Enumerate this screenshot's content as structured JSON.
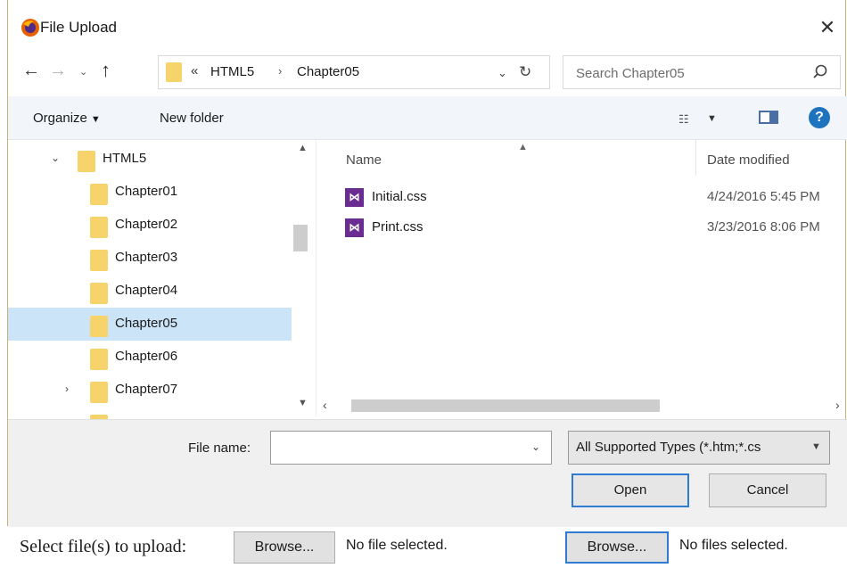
{
  "dialog": {
    "title": "File Upload",
    "close_symbol": "✕",
    "nav": {
      "back_symbol": "←",
      "forward_symbol": "→",
      "recent_symbol": "⌄",
      "up_symbol": "↑"
    },
    "address": {
      "overflow": "«",
      "segments": [
        "HTML5",
        "Chapter05"
      ],
      "separator": "›",
      "dropdown_symbol": "⌄",
      "refresh_symbol": "↻"
    },
    "search": {
      "placeholder": "Search Chapter05",
      "value": ""
    },
    "toolbar": {
      "organize_label": "Organize",
      "new_folder_label": "New folder",
      "help_symbol": "?",
      "view_symbol": "☷",
      "caret": "▼"
    },
    "nav_tree": [
      {
        "label": "HTML5",
        "expanded": true,
        "selected": false
      },
      {
        "label": "Chapter01",
        "selected": false
      },
      {
        "label": "Chapter02",
        "selected": false
      },
      {
        "label": "Chapter03",
        "selected": false
      },
      {
        "label": "Chapter04",
        "selected": false
      },
      {
        "label": "Chapter05",
        "selected": true
      },
      {
        "label": "Chapter06",
        "selected": false
      },
      {
        "label": "Chapter07",
        "collapsed": true,
        "selected": false
      }
    ],
    "file_list": {
      "columns": [
        "Name",
        "Date modified"
      ],
      "files": [
        {
          "name": "Initial.css",
          "date": "4/24/2016 5:45 PM",
          "icon": "css-file-icon"
        },
        {
          "name": "Print.css",
          "date": "3/23/2016 8:06 PM",
          "icon": "css-file-icon"
        }
      ]
    },
    "file_name": {
      "label": "File name:",
      "value": ""
    },
    "file_type": {
      "selected": "All Supported Types (*.htm;*.cs"
    },
    "buttons": {
      "open": "Open",
      "cancel": "Cancel"
    }
  },
  "page": {
    "label": "Select file(s) to upload:",
    "uploads": [
      {
        "browse": "Browse...",
        "status": "No file selected."
      },
      {
        "browse": "Browse...",
        "status": "No files selected."
      }
    ]
  },
  "colors": {
    "accent": "#2f7bd1",
    "selection": "#cce4f7",
    "folder": "#f7d36b",
    "css_icon": "#6b2c91"
  }
}
